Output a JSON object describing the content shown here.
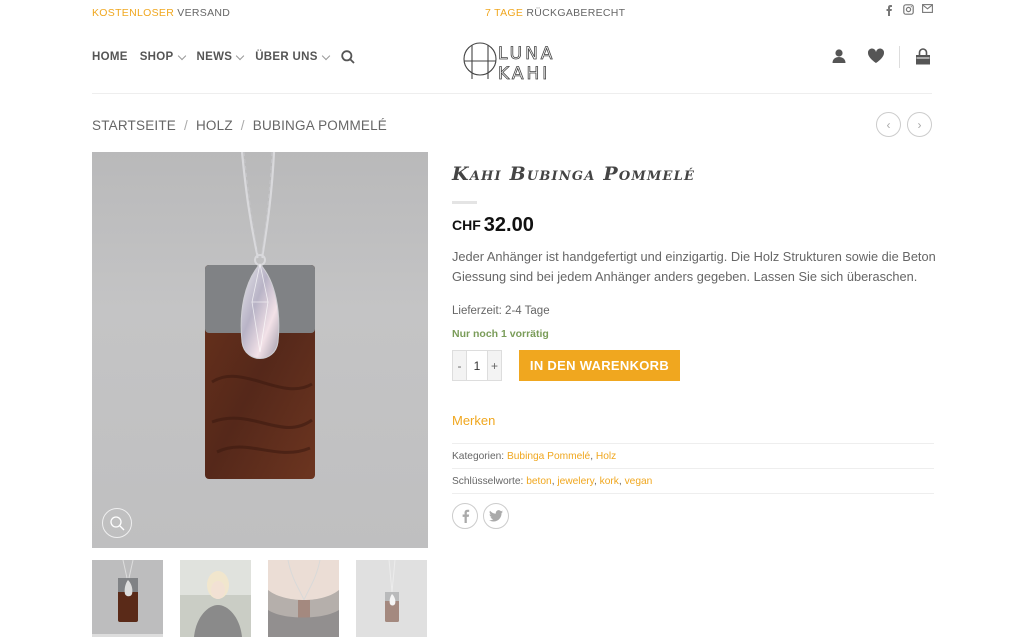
{
  "topbar": {
    "shipping_hl": "KOSTENLOSER",
    "shipping_rest": "VERSAND",
    "return_hl": "7 TAGE",
    "return_rest": "RÜCKGABERECHT",
    "social_icons": [
      "facebook-icon",
      "instagram-icon",
      "mail-icon"
    ]
  },
  "nav": {
    "items": [
      {
        "label": "HOME",
        "dropdown": false
      },
      {
        "label": "SHOP",
        "dropdown": true
      },
      {
        "label": "NEWS",
        "dropdown": true
      },
      {
        "label": "ÜBER UNS",
        "dropdown": true
      }
    ],
    "search_icon": "search-icon"
  },
  "logo": {
    "line1": "LUNA",
    "line2": "KAHI"
  },
  "header_icons": [
    "user-icon",
    "heart-icon",
    "bag-icon"
  ],
  "breadcrumb": {
    "items": [
      "STARTSEITE",
      "HOLZ",
      "BUBINGA POMMELÉ"
    ],
    "separator": "/"
  },
  "pager": {
    "prev": "‹",
    "next": "›"
  },
  "product": {
    "title": "Kahi Bubinga Pommelé",
    "currency": "CHF",
    "price": "32.00",
    "description": "Jeder Anhänger ist handgefertigt und einzigartig. Die Holz Strukturen sowie die Beton Giessung sind bei jedem Anhänger anders gegeben. Lassen Sie sich überaschen.",
    "delivery": "Lieferzeit: 2-4 Tage",
    "stock": "Nur noch 1 vorrätig",
    "quantity": "1",
    "qty_minus": "-",
    "qty_plus": "+",
    "add_to_cart": "IN DEN WARENKORB",
    "wishlist": "Merken",
    "categories_label": "Kategorien:",
    "categories": [
      "Bubinga Pommelé",
      "Holz"
    ],
    "tags_label": "Schlüsselworte:",
    "tags": [
      "beton",
      "jewelery",
      "kork",
      "vegan"
    ],
    "share": [
      "f",
      "t"
    ]
  },
  "colors": {
    "accent": "#f0a71f",
    "stock": "#7a9c59",
    "wood": "#5a2a18"
  }
}
